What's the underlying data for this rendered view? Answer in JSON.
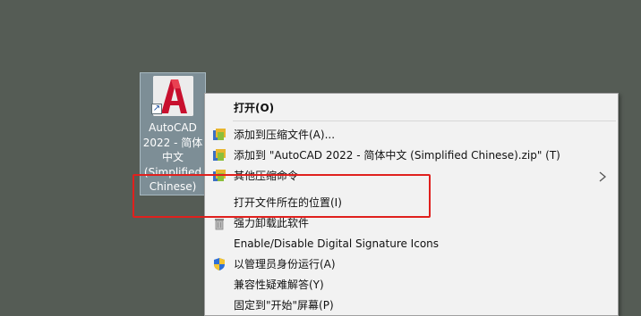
{
  "desktop_icon": {
    "label": "AutoCAD\n2022 - 简体\n中文\n(Simplified\nChinese)"
  },
  "context_menu": {
    "items": [
      {
        "label": "打开(O)",
        "icon": "none"
      },
      {
        "label": "添加到压缩文件(A)...",
        "icon": "archive-icon"
      },
      {
        "label": "添加到 \"AutoCAD 2022 - 简体中文 (Simplified Chinese).zip\" (T)",
        "icon": "archive-icon"
      },
      {
        "label": "其他压缩命令",
        "icon": "archive-icon"
      },
      {
        "label": "打开文件所在的位置(I)",
        "icon": "none"
      },
      {
        "label": "强力卸载此软件",
        "icon": "trash-icon"
      },
      {
        "label": "Enable/Disable Digital Signature Icons",
        "icon": "none"
      },
      {
        "label": "以管理员身份运行(A)",
        "icon": "shield-icon"
      },
      {
        "label": "兼容性疑难解答(Y)",
        "icon": "none"
      },
      {
        "label": "固定到\"开始\"屏幕(P)",
        "icon": "none"
      }
    ]
  },
  "colors": {
    "desktop": "#555c55",
    "menu_bg": "#f2f2f2",
    "highlight_box": "#e0201d"
  }
}
